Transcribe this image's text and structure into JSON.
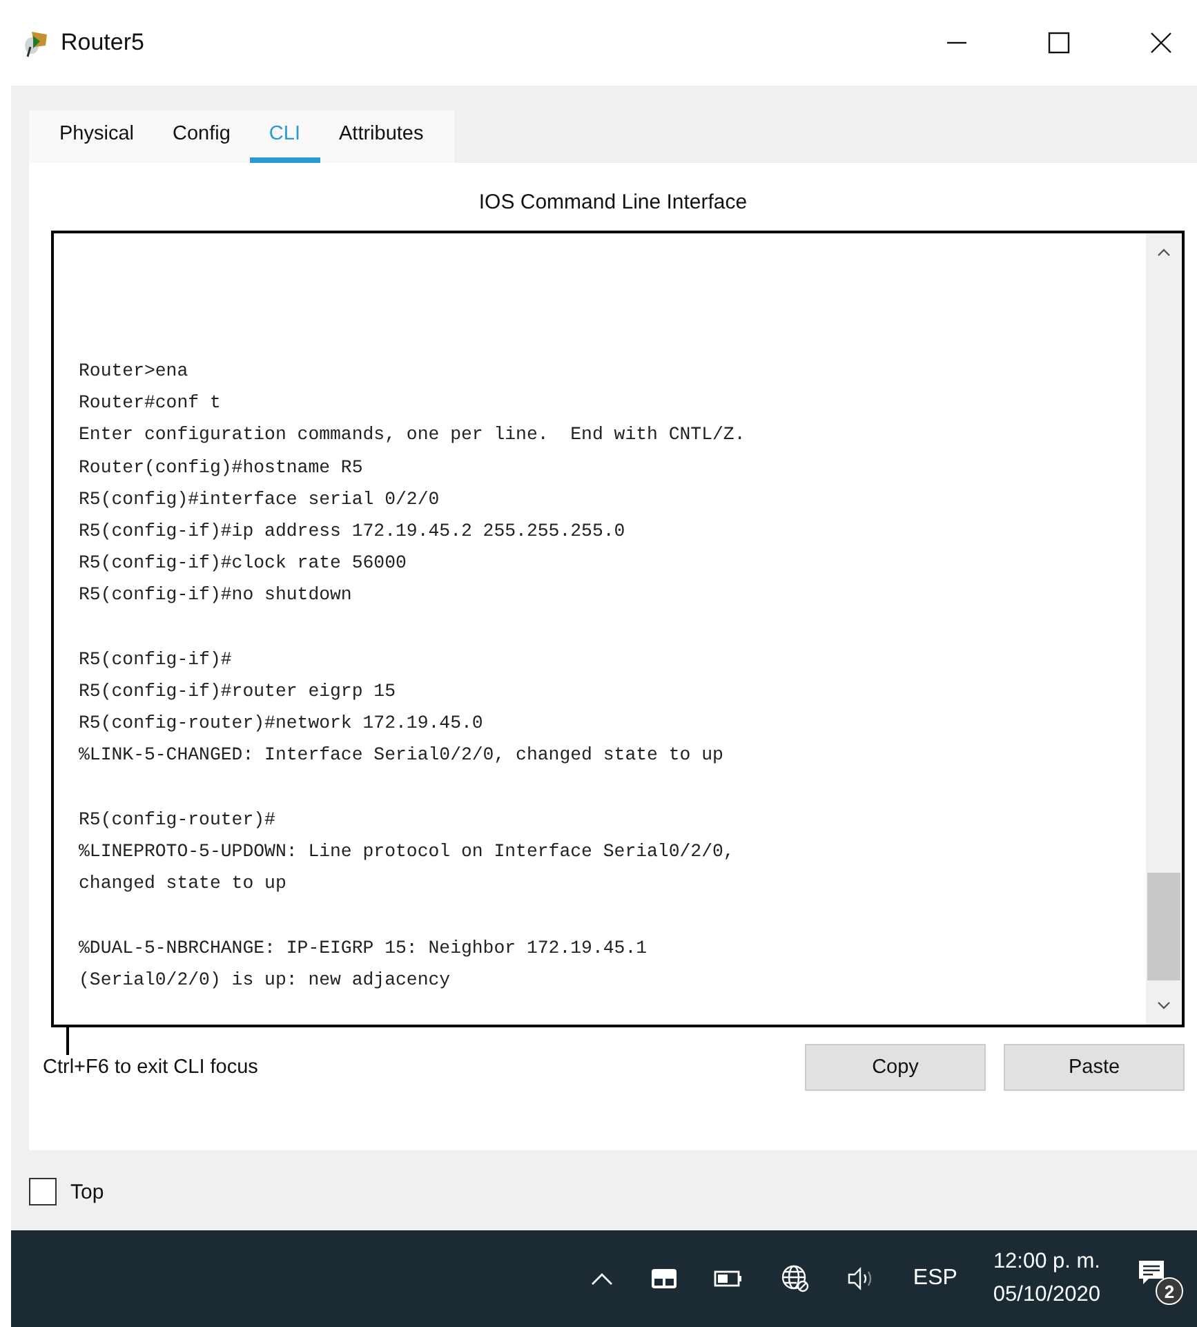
{
  "window": {
    "title": "Router5"
  },
  "tabs": [
    {
      "label": "Physical",
      "selected": false
    },
    {
      "label": "Config",
      "selected": false
    },
    {
      "label": "CLI",
      "selected": true
    },
    {
      "label": "Attributes",
      "selected": false
    }
  ],
  "panel_title": "IOS Command Line Interface",
  "terminal": {
    "blocks": [
      [
        "Router>ena",
        "Router#conf t",
        "Enter configuration commands, one per line.  End with CNTL/Z.",
        "Router(config)#hostname R5",
        "R5(config)#interface serial 0/2/0",
        "R5(config-if)#ip address 172.19.45.2 255.255.255.0",
        "R5(config-if)#clock rate 56000",
        "R5(config-if)#no shutdown"
      ],
      [
        "R5(config-if)#",
        "R5(config-if)#router eigrp 15",
        "R5(config-router)#network 172.19.45.0",
        "%LINK-5-CHANGED: Interface Serial0/2/0, changed state to up"
      ],
      [
        "R5(config-router)#",
        "%LINEPROTO-5-UPDOWN: Line protocol on Interface Serial0/2/0,",
        "changed state to up"
      ],
      [
        "%DUAL-5-NBRCHANGE: IP-EIGRP 15: Neighbor 172.19.45.1",
        "(Serial0/2/0) is up: new adjacency"
      ]
    ]
  },
  "hint": "Ctrl+F6 to exit CLI focus",
  "buttons": [
    "Copy",
    "Paste"
  ],
  "top_checkbox": {
    "label": "Top",
    "checked": false
  },
  "taskbar": {
    "language": "ESP",
    "time": "12:00 p. m.",
    "date": "05/10/2020",
    "notification_count": "2"
  }
}
